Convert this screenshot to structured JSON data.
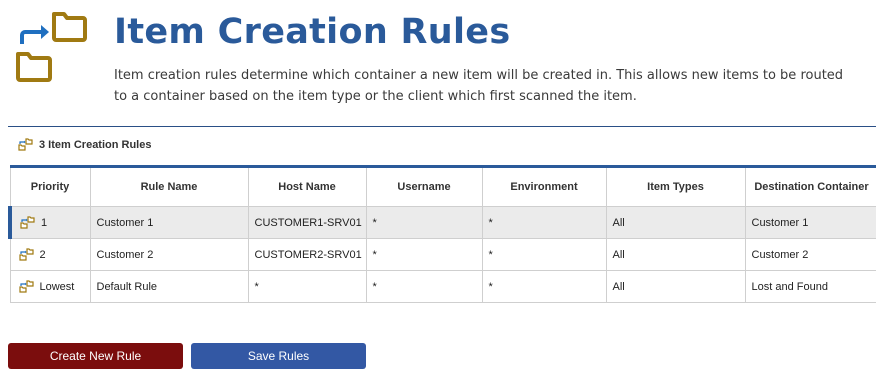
{
  "page": {
    "title": "Item Creation Rules",
    "description": "Item creation rules determine which container a new item will be created in. This allows new items to be routed to a container based on the item type or the client which first scanned the item."
  },
  "rules_section": {
    "label": "3 Item Creation Rules"
  },
  "table": {
    "columns": [
      "Priority",
      "Rule Name",
      "Host Name",
      "Username",
      "Environment",
      "Item Types",
      "Destination Container"
    ],
    "rows": [
      {
        "priority": "1",
        "rule_name": "Customer 1",
        "host_name": "CUSTOMER1-SRV01",
        "username": "*",
        "environment": "*",
        "item_types": "All",
        "destination": "Customer 1",
        "selected": true
      },
      {
        "priority": "2",
        "rule_name": "Customer 2",
        "host_name": "CUSTOMER2-SRV01",
        "username": "*",
        "environment": "*",
        "item_types": "All",
        "destination": "Customer 2",
        "selected": false
      },
      {
        "priority": "Lowest",
        "rule_name": "Default Rule",
        "host_name": "*",
        "username": "*",
        "environment": "*",
        "item_types": "All",
        "destination": "Lost and Found",
        "selected": false
      }
    ]
  },
  "buttons": {
    "create_label": "Create New Rule",
    "save_label": "Save Rules"
  },
  "icons": {
    "header": "folder-route-icon",
    "row": "folder-route-icon"
  },
  "colors": {
    "title": "#2a5a9a",
    "accent": "#2a5a9a",
    "folder": "#a07a12",
    "arrow": "#1f6fc0",
    "create_button": "#7b0d0d",
    "save_button": "#3358a4"
  }
}
